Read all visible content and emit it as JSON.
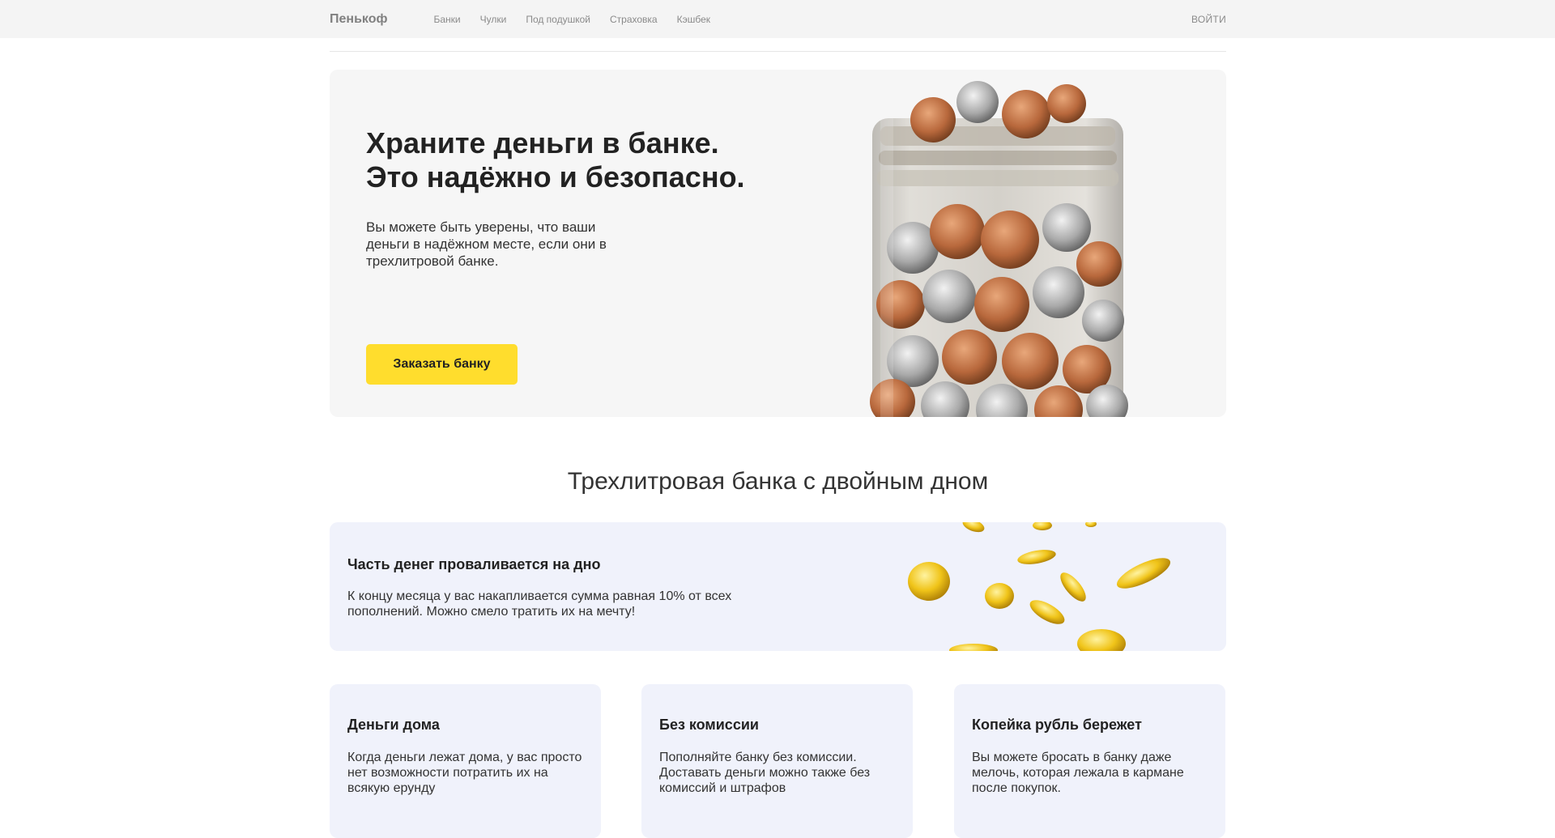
{
  "header": {
    "logo": "Пенькоф",
    "nav": [
      "Банки",
      "Чулки",
      "Под подушкой",
      "Страховка",
      "Кэшбек"
    ],
    "login": "ВОЙТИ"
  },
  "hero": {
    "title_line1": "Храните деньги в банке.",
    "title_line2": "Это надёжно и безопасно.",
    "text": "Вы можете быть уверены, что ваши деньги в надёжном месте, если они в  трехлитровой банке.",
    "button": "Заказать банку"
  },
  "section": {
    "title": "Трехлитровая банка с двойным дном"
  },
  "feature_wide": {
    "title": "Часть денег проваливается на дно",
    "text": "К концу месяца у вас накапливается сумма равная 10% от  всех пополнений. Можно смело тратить их на мечту!"
  },
  "cards": [
    {
      "title": "Деньги дома",
      "text": "Когда деньги лежат дома, у вас просто нет возможности потратить их на всякую ерунду"
    },
    {
      "title": "Без комиссии",
      "text": "Пополняйте банку без комиссии. Доставать деньги можно также без комиссий и штрафов"
    },
    {
      "title": "Копейка рубль бережет",
      "text": "Вы можете бросать в банку даже мелочь, которая лежала в кармане после покупок."
    }
  ],
  "colors": {
    "accent": "#ffdd2d",
    "card_bg": "#f0f2fb",
    "hero_bg": "#f6f6f6",
    "topbar_bg": "#f4f4f4"
  },
  "images": {
    "hero": "jar-of-coins",
    "feature": "falling-gold-coins"
  }
}
